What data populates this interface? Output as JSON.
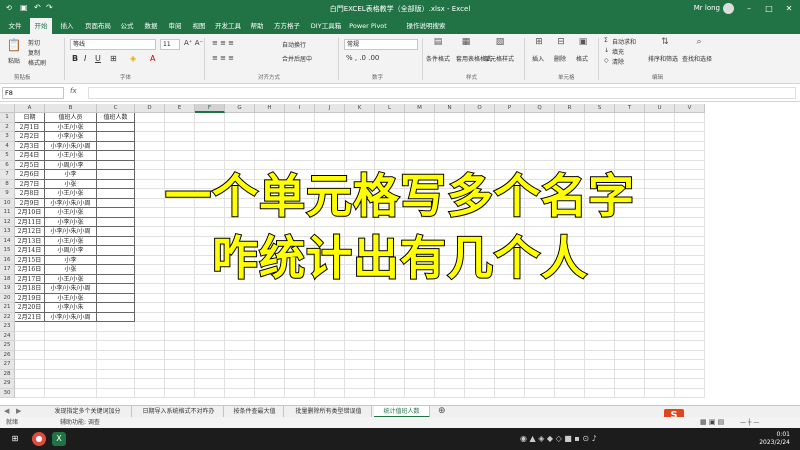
{
  "window": {
    "title": "白門EXCEL表格教学（全部版）.xlsx - Excel",
    "user": "Mr long"
  },
  "tabs": [
    "文件",
    "开始",
    "插入",
    "页面布局",
    "公式",
    "数据",
    "审阅",
    "视图",
    "开发工具",
    "帮助",
    "方方格子",
    "DIY工具箱",
    "Power Pivot",
    "操作说明搜索"
  ],
  "ribbon": {
    "paste": "粘贴",
    "cut": "剪切",
    "copy": "复制",
    "format_painter": "格式刷",
    "font_name": "等线",
    "font_size": "11",
    "wrap": "自动换行",
    "merge": "合并后居中",
    "number_format": "常规",
    "cond_format": "条件格式",
    "table_format": "套用表格格式",
    "cell_style": "单元格样式",
    "insert": "插入",
    "delete": "删除",
    "format": "格式",
    "autosum": "自动求和",
    "fill": "填充",
    "clear": "清除",
    "sort": "排序和筛选",
    "find": "查找和选择",
    "groups": [
      "剪贴板",
      "字体",
      "对齐方式",
      "数字",
      "样式",
      "单元格",
      "编辑"
    ]
  },
  "formula": {
    "namebox": "F8",
    "fx": "fx",
    "value": ""
  },
  "columns": [
    "A",
    "B",
    "C",
    "D",
    "E",
    "F",
    "G",
    "H",
    "I",
    "J",
    "K",
    "L",
    "M",
    "N",
    "O",
    "P",
    "Q",
    "R",
    "S",
    "T",
    "U",
    "V"
  ],
  "selected_column": "F",
  "rows": [
    "1",
    "2",
    "3",
    "4",
    "5",
    "6",
    "7",
    "8",
    "9",
    "10",
    "11",
    "12",
    "13",
    "14",
    "15",
    "16",
    "17",
    "18",
    "19",
    "20",
    "21",
    "22",
    "23",
    "24",
    "25",
    "26",
    "27",
    "28",
    "29",
    "30"
  ],
  "table": {
    "headers": [
      "日期",
      "值班人员",
      "值班人数"
    ],
    "rows": [
      [
        "2月1日",
        "小王/小张"
      ],
      [
        "2月2日",
        "小李/小张"
      ],
      [
        "2月3日",
        "小李/小朱/小周"
      ],
      [
        "2月4日",
        "小王/小张"
      ],
      [
        "2月5日",
        "小周/小李"
      ],
      [
        "2月6日",
        "小李"
      ],
      [
        "2月7日",
        "小张"
      ],
      [
        "2月8日",
        "小王/小张"
      ],
      [
        "2月9日",
        "小李/小朱/小周"
      ],
      [
        "2月10日",
        "小王/小张"
      ],
      [
        "2月11日",
        "小李/小张"
      ],
      [
        "2月12日",
        "小李/小朱/小周"
      ],
      [
        "2月13日",
        "小王/小张"
      ],
      [
        "2月14日",
        "小周/小李"
      ],
      [
        "2月15日",
        "小李"
      ],
      [
        "2月16日",
        "小张"
      ],
      [
        "2月17日",
        "小王/小张"
      ],
      [
        "2月18日",
        "小李/小朱/小周"
      ],
      [
        "2月19日",
        "小王/小张"
      ],
      [
        "2月20日",
        "小李/小朱"
      ],
      [
        "2月21日",
        "小李/小朱/小周"
      ]
    ]
  },
  "overlay": {
    "line1": "一个单元格写多个名字",
    "line2": "咋统计出有几个人"
  },
  "sheet_tabs": [
    "发现指定多个关键词加分",
    "日期导入系统格式不对咋办",
    "按条件查最大值",
    "批量删除所有类型错误值",
    "统计值班人数"
  ],
  "active_sheet": "统计值班人数",
  "status": {
    "left": "就绪",
    "accessibility": "辅助功能: 调查"
  },
  "taskbar": {
    "time": "0:01",
    "date": "2023/2/24"
  },
  "colors": {
    "excel_green": "#217346",
    "overlay_text": "#ffff00"
  }
}
